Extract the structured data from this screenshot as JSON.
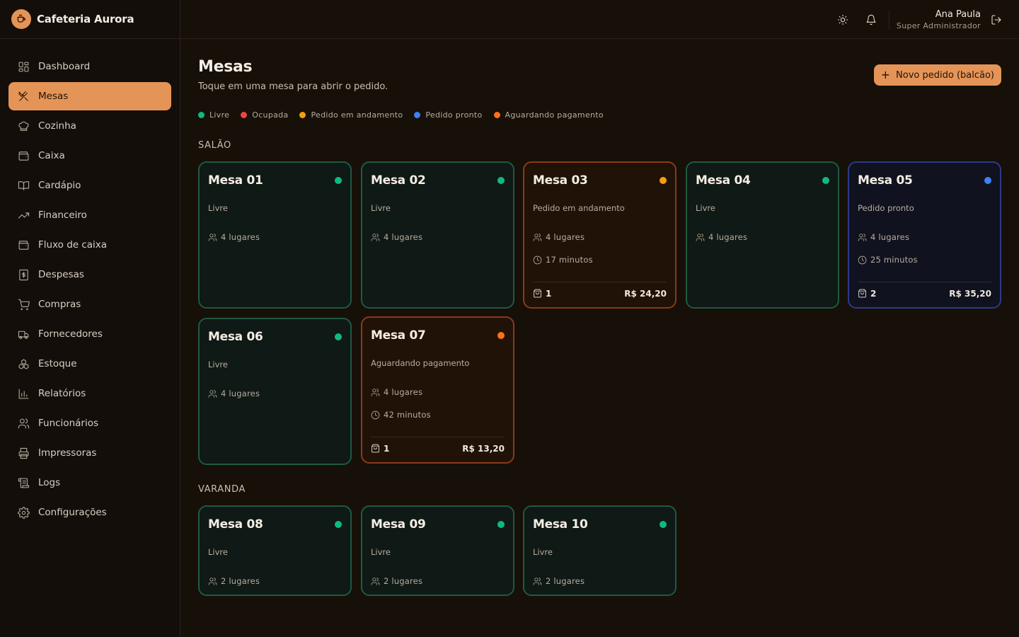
{
  "brand": {
    "name": "Cafeteria Aurora"
  },
  "colors": {
    "accent": "#e59457",
    "livre": "#10b981",
    "ocupada": "#ef4444",
    "andamento": "#f59e0b",
    "pronto": "#3b82f6",
    "pagamento": "#f97316"
  },
  "sidebar": {
    "items": [
      {
        "label": "Dashboard",
        "icon": "dashboard-icon"
      },
      {
        "label": "Mesas",
        "icon": "utensils-icon",
        "active": true
      },
      {
        "label": "Cozinha",
        "icon": "chef-hat-icon"
      },
      {
        "label": "Caixa",
        "icon": "wallet-icon"
      },
      {
        "label": "Cardápio",
        "icon": "book-icon"
      },
      {
        "label": "Financeiro",
        "icon": "trending-up-icon"
      },
      {
        "label": "Fluxo de caixa",
        "icon": "wallet-icon"
      },
      {
        "label": "Despesas",
        "icon": "receipt-icon"
      },
      {
        "label": "Compras",
        "icon": "cart-icon"
      },
      {
        "label": "Fornecedores",
        "icon": "truck-icon"
      },
      {
        "label": "Estoque",
        "icon": "boxes-icon"
      },
      {
        "label": "Relatórios",
        "icon": "bar-chart-icon"
      },
      {
        "label": "Funcionários",
        "icon": "users-icon"
      },
      {
        "label": "Impressoras",
        "icon": "printer-icon"
      },
      {
        "label": "Logs",
        "icon": "scroll-icon"
      },
      {
        "label": "Configurações",
        "icon": "gear-icon"
      }
    ]
  },
  "header": {
    "user_name": "Ana Paula",
    "user_role": "Super Administrador"
  },
  "page": {
    "title": "Mesas",
    "subtitle": "Toque em uma mesa para abrir o pedido.",
    "new_order_label": "Novo pedido (balcão)"
  },
  "legend": [
    {
      "label": "Livre",
      "color": "#10b981"
    },
    {
      "label": "Ocupada",
      "color": "#ef4444"
    },
    {
      "label": "Pedido em andamento",
      "color": "#f59e0b"
    },
    {
      "label": "Pedido pronto",
      "color": "#3b82f6"
    },
    {
      "label": "Aguardando pagamento",
      "color": "#f97316"
    }
  ],
  "sections": [
    {
      "title": "SALÃO"
    },
    {
      "title": "VARANDA"
    }
  ],
  "tables": [
    {
      "name": "Mesa 01",
      "status": "Livre",
      "seats": "4 lugares",
      "dot": "#10b981"
    },
    {
      "name": "Mesa 02",
      "status": "Livre",
      "seats": "4 lugares",
      "dot": "#10b981"
    },
    {
      "name": "Mesa 03",
      "status": "Pedido em andamento",
      "seats": "4 lugares",
      "time": "17 minutos",
      "items": "1",
      "total": "R$ 24,20",
      "dot": "#f59e0b"
    },
    {
      "name": "Mesa 04",
      "status": "Livre",
      "seats": "4 lugares",
      "dot": "#10b981"
    },
    {
      "name": "Mesa 05",
      "status": "Pedido pronto",
      "seats": "4 lugares",
      "time": "25 minutos",
      "items": "2",
      "total": "R$ 35,20",
      "dot": "#3b82f6"
    },
    {
      "name": "Mesa 06",
      "status": "Livre",
      "seats": "4 lugares",
      "dot": "#10b981"
    },
    {
      "name": "Mesa 07",
      "status": "Aguardando pagamento",
      "seats": "4 lugares",
      "time": "42 minutos",
      "items": "1",
      "total": "R$ 13,20",
      "dot": "#f97316"
    },
    {
      "name": "Mesa 08",
      "status": "Livre",
      "seats": "2 lugares",
      "dot": "#10b981"
    },
    {
      "name": "Mesa 09",
      "status": "Livre",
      "seats": "2 lugares",
      "dot": "#10b981"
    },
    {
      "name": "Mesa 10",
      "status": "Livre",
      "seats": "2 lugares",
      "dot": "#10b981"
    }
  ]
}
